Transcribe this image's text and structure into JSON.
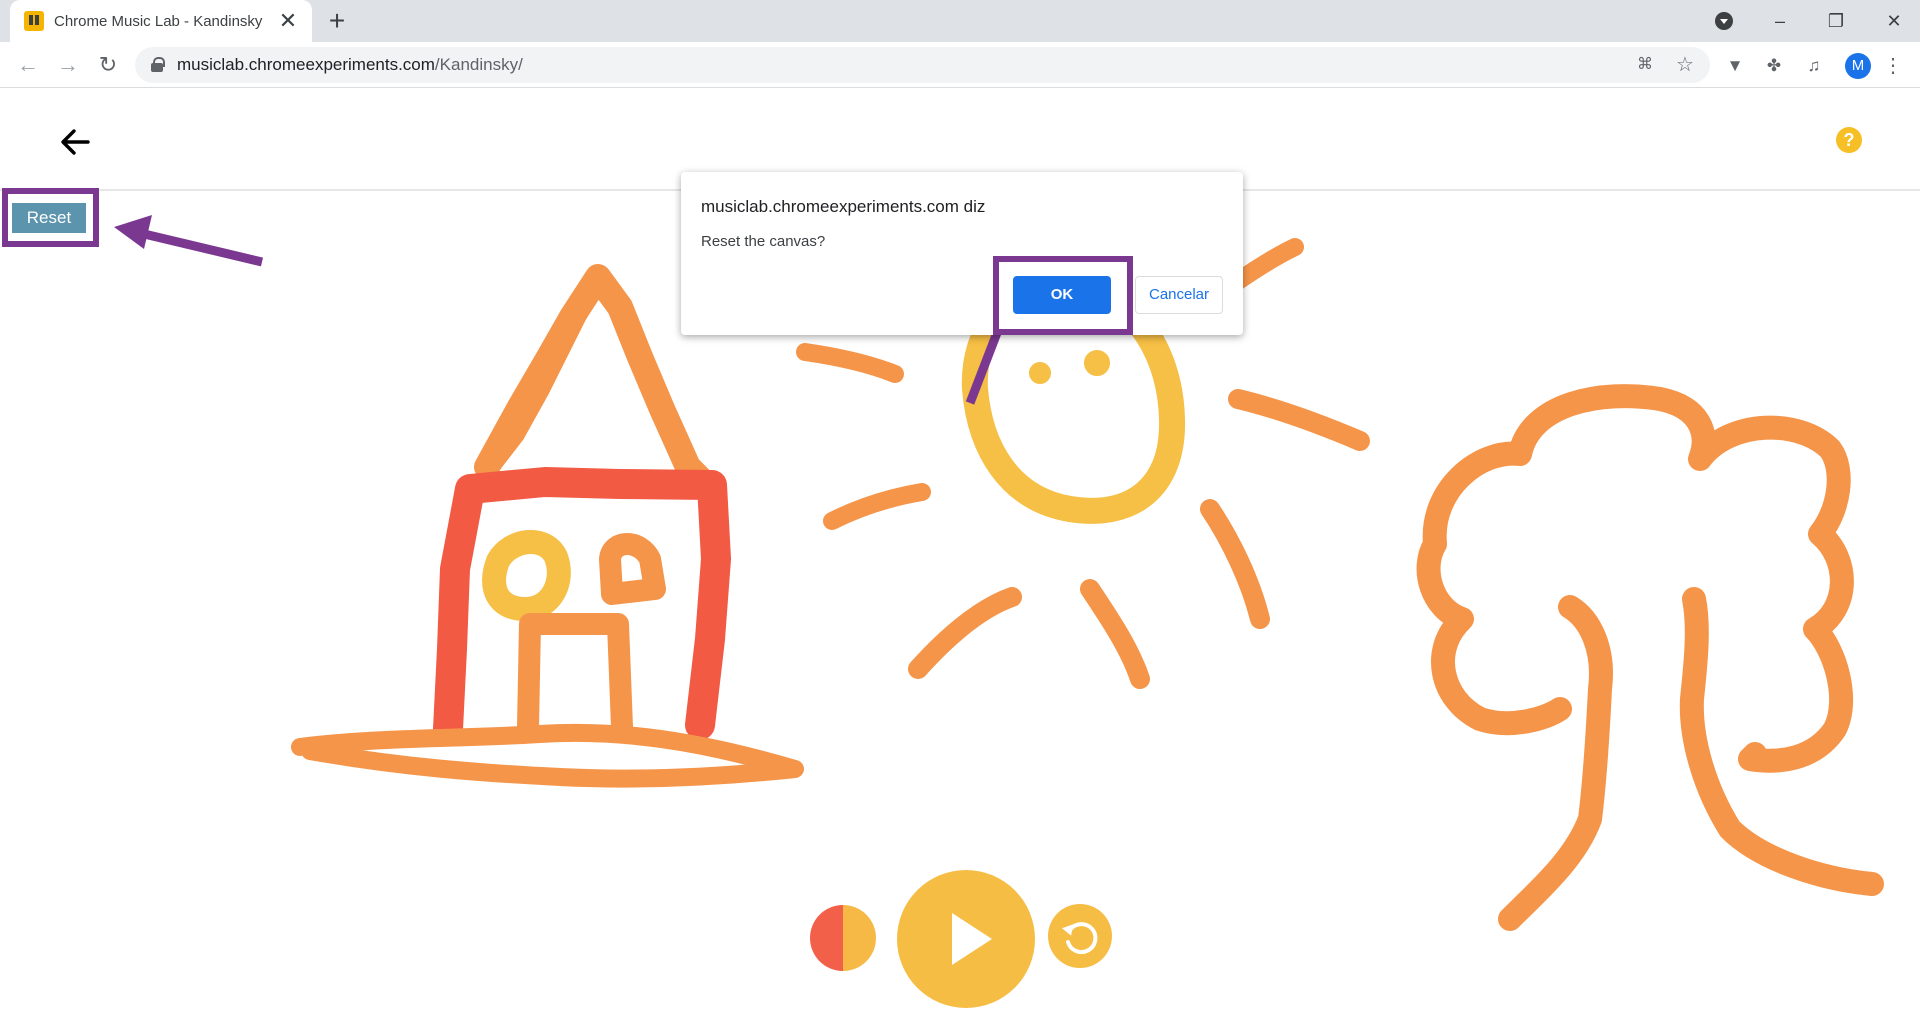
{
  "browser": {
    "tab": {
      "title": "Chrome Music Lab - Kandinsky",
      "close_glyph": "✕",
      "favicon": "chrome-music-lab-favicon"
    },
    "new_tab_glyph": "+",
    "window_controls": {
      "minimize": "–",
      "restore": "❐",
      "close": "✕"
    },
    "nav": {
      "back": "←",
      "forward": "→",
      "reload": "↻"
    },
    "address_bar": {
      "host": "musiclab.chromeexperiments.com",
      "path": "/Kandinsky/"
    },
    "omnibox_icons": {
      "translate": "⌘",
      "bookmark": "☆"
    },
    "extensions": {
      "ext1": "▼",
      "puzzle": "✤",
      "media": "♫"
    },
    "profile_initial": "M",
    "menu_glyph": "⋮"
  },
  "page": {
    "back_glyph": "←",
    "help_glyph": "?",
    "reset_label": "Reset",
    "colors": {
      "orange": "#f5954a",
      "red": "#f25a44",
      "yellow": "#f6bf45",
      "annotation_purple": "#7b3891"
    }
  },
  "dialog": {
    "title": "musiclab.chromeexperiments.com diz",
    "message": "Reset the canvas?",
    "ok_label": "OK",
    "cancel_label": "Cancelar"
  },
  "controls": {
    "color_toggle": "color-toggle",
    "play": "play",
    "undo_glyph": "↺"
  }
}
